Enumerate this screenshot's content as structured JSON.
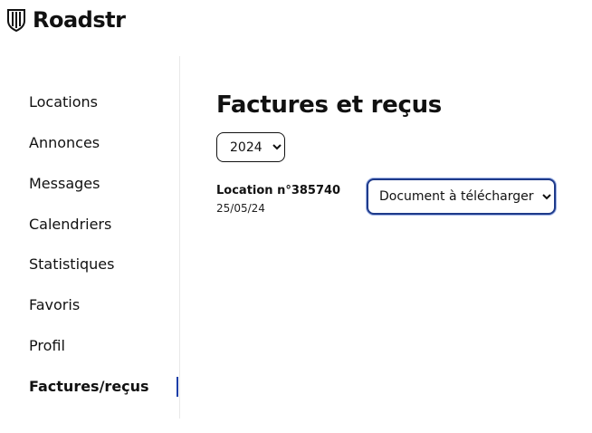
{
  "brand": {
    "name": "Roadstr",
    "icon": "shield-stripes-icon"
  },
  "sidebar": {
    "items": [
      {
        "label": "Locations",
        "active": false
      },
      {
        "label": "Annonces",
        "active": false
      },
      {
        "label": "Messages",
        "active": false
      },
      {
        "label": "Calendriers",
        "active": false
      },
      {
        "label": "Statistiques",
        "active": false
      },
      {
        "label": "Favoris",
        "active": false
      },
      {
        "label": "Profil",
        "active": false
      },
      {
        "label": "Factures/reçus",
        "active": true
      }
    ],
    "active_indicator_color": "#1a3ea8"
  },
  "main": {
    "title": "Factures et reçus",
    "year_select": {
      "value": "2024"
    },
    "rentals": [
      {
        "title": "Location n°385740",
        "date": "25/05/24",
        "document_select": {
          "value": "Document à télécharger"
        }
      }
    ]
  },
  "colors": {
    "accent": "#1e3a8a",
    "text": "#111111"
  }
}
